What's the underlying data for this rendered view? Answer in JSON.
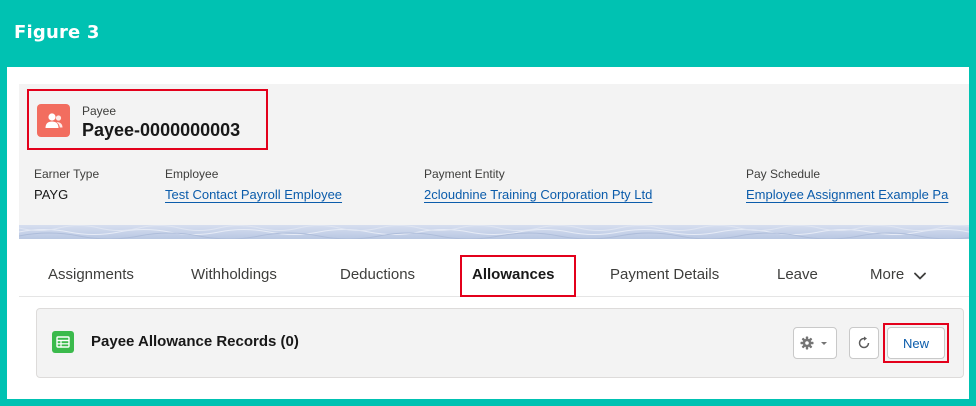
{
  "figure": {
    "title": "Figure 3"
  },
  "record": {
    "object_label": "Payee",
    "name": "Payee-0000000003",
    "icon": "contact-user-icon"
  },
  "fields": [
    {
      "label": "Earner Type",
      "value": "PAYG",
      "is_link": false
    },
    {
      "label": "Employee",
      "value": "Test Contact Payroll Employee",
      "is_link": true
    },
    {
      "label": "Payment Entity",
      "value": "2cloudnine Training Corporation Pty Ltd",
      "is_link": true
    },
    {
      "label": "Pay Schedule",
      "value": "Employee Assignment Example Pa",
      "is_link": true
    }
  ],
  "tabs": [
    {
      "label": "Assignments",
      "active": false
    },
    {
      "label": "Withholdings",
      "active": false
    },
    {
      "label": "Deductions",
      "active": false
    },
    {
      "label": "Allowances",
      "active": true
    },
    {
      "label": "Payment Details",
      "active": false
    },
    {
      "label": "Leave",
      "active": false
    },
    {
      "label": "More",
      "active": false,
      "icon": "chevron-down-icon"
    }
  ],
  "related_list": {
    "title": "Payee Allowance Records (0)",
    "icon": "table-icon",
    "actions": {
      "settings_icon": "gear-icon",
      "dropdown_icon": "caret-down-icon",
      "refresh_icon": "refresh-icon",
      "new_label": "New"
    }
  },
  "colors": {
    "frame": "#00c2b2",
    "highlight": "#e3001b",
    "record_icon": "#f26d5f",
    "card_icon": "#3bba4c",
    "link": "#0b5cab"
  }
}
